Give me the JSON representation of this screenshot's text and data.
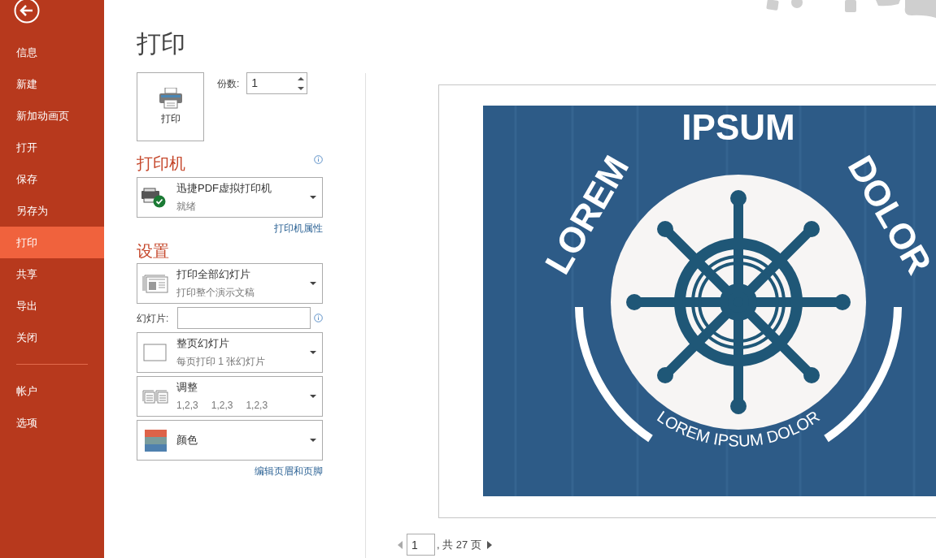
{
  "sidebar": {
    "items": [
      {
        "label": "信息",
        "selected": false
      },
      {
        "label": "新建",
        "selected": false
      },
      {
        "label": "新加动画页",
        "selected": false
      },
      {
        "label": "打开",
        "selected": false
      },
      {
        "label": "保存",
        "selected": false
      },
      {
        "label": "另存为",
        "selected": false
      },
      {
        "label": "打印",
        "selected": true
      },
      {
        "label": "共享",
        "selected": false
      },
      {
        "label": "导出",
        "selected": false
      },
      {
        "label": "关闭",
        "selected": false
      }
    ],
    "bottom_items": [
      {
        "label": "帐户",
        "selected": false
      },
      {
        "label": "选项",
        "selected": false
      }
    ]
  },
  "page_title": "打印",
  "print_button": "打印",
  "copies": {
    "label": "份数:",
    "value": "1"
  },
  "printer": {
    "heading": "打印机",
    "name": "迅捷PDF虚拟打印机",
    "status": "就绪",
    "link": "打印机属性"
  },
  "settings": {
    "heading": "设置",
    "items": [
      {
        "kind": "pages",
        "title": "打印全部幻灯片",
        "subtitle": "打印整个演示文稿"
      },
      {
        "kind": "field",
        "label": "幻灯片:"
      },
      {
        "kind": "layout",
        "title": "整页幻灯片",
        "subtitle": "每页打印 1 张幻灯片"
      },
      {
        "kind": "collate",
        "title": "调整",
        "groups": [
          "1,2,3",
          "1,2,3",
          "1,2,3"
        ]
      },
      {
        "kind": "color",
        "title": "颜色"
      }
    ],
    "link": "编辑页眉和页脚"
  },
  "preview": {
    "slide_title": "LOREM IPSUM DOLOR",
    "slide_subtitle": "LOREM IPSUM DOLOR"
  },
  "pager": {
    "page": "1",
    "total": ", 共 27 页"
  }
}
